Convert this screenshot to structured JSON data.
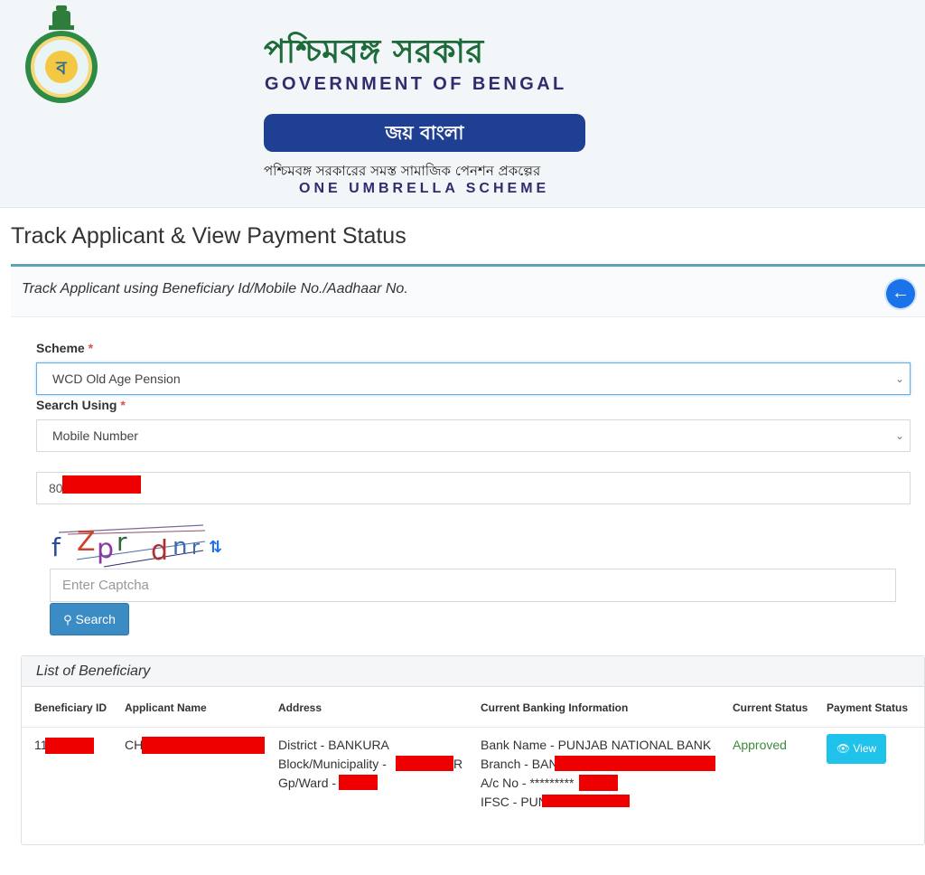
{
  "header": {
    "bn_title": "পশ্চিমবঙ্গ সরকার",
    "en_title": "GOVERNMENT OF BENGAL",
    "joy_bangla": "জয় বাংলা",
    "bn_subtitle": "পশ্চিমবঙ্গ সরকারের সমস্ত সামাজিক পেনশন প্রকল্পের",
    "en_subtitle": "ONE UMBRELLA SCHEME"
  },
  "page": {
    "title": "Track Applicant & View Payment Status"
  },
  "panel": {
    "heading": "Track Applicant using Beneficiary Id/Mobile No./Aadhaar No.",
    "back_icon": "arrow-left-icon"
  },
  "form": {
    "scheme_label": "Scheme",
    "required_mark": "*",
    "scheme_value": "WCD Old Age Pension",
    "search_using_label": "Search Using",
    "search_using_value": "Mobile Number",
    "mobile_prefix": "80",
    "captcha_text": "f Zpr dn",
    "captcha_placeholder": "Enter Captcha",
    "search_label": "Search",
    "search_icon": "search-icon",
    "refresh_icon": "refresh-icon"
  },
  "list": {
    "heading": "List of Beneficiary",
    "columns": [
      "Beneficiary ID",
      "Applicant Name",
      "Address",
      "Current Banking Information",
      "Current Status",
      "Payment Status"
    ],
    "rows": [
      {
        "beneficiary_id_prefix": "11",
        "applicant_name_prefix": "CH",
        "address_district": "District - BANKURA",
        "address_block": "Block/Municipality -",
        "address_block_suffix": "R",
        "address_gp": "Gp/Ward -",
        "bank_name": "Bank Name - PUNJAB NATIONAL BANK",
        "branch": "Branch - BAN",
        "account": "A/c No - *********",
        "ifsc": "IFSC - PUN",
        "current_status": "Approved",
        "payment_button": "View",
        "payment_icon": "eye-icon"
      }
    ]
  },
  "colors": {
    "brand_green": "#1e6b3a",
    "brand_navy": "#1f3f93",
    "panel_accent": "#5aa3b8",
    "search_button": "#3b8bc4",
    "view_button": "#1ec2ea",
    "approved": "#3c8a3c",
    "redaction": "#ee0000"
  }
}
